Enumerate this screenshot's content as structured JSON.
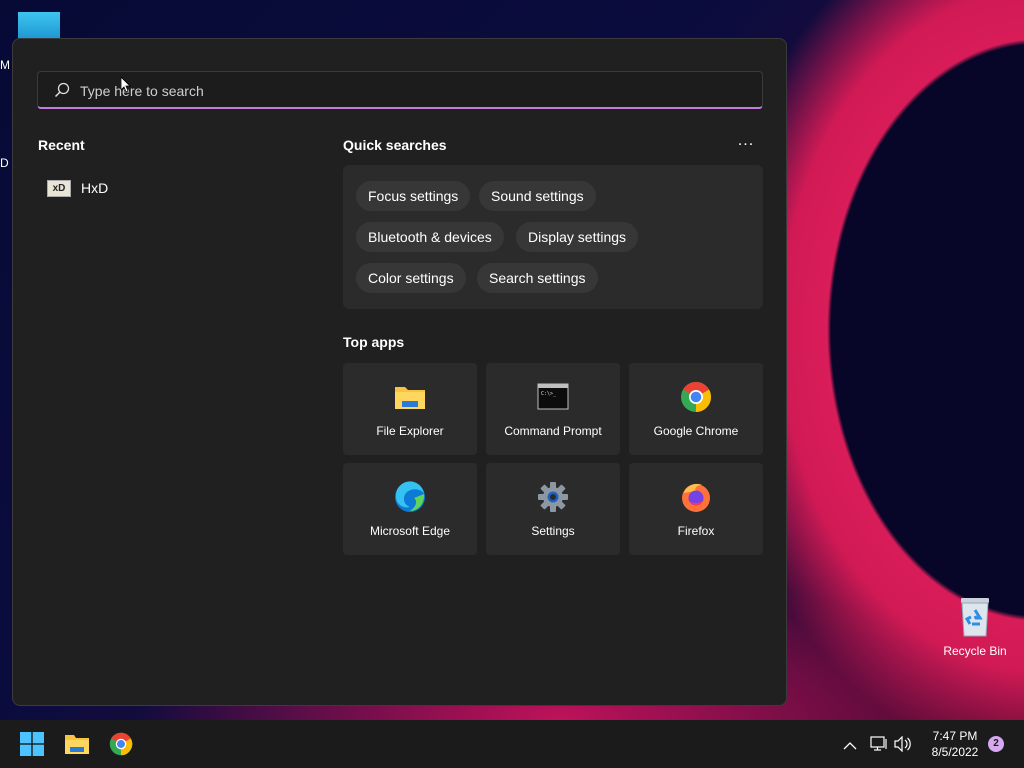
{
  "desktop": {
    "fragment_m": "M",
    "fragment_d": "D",
    "recycle_bin_label": "Recycle Bin"
  },
  "start": {
    "search_placeholder": "Type here to search",
    "recent_title": "Recent",
    "recent_items": [
      {
        "label": "HxD",
        "icon": "hxd-icon"
      }
    ],
    "quick_searches_title": "Quick searches",
    "more_label": "...",
    "quick_searches": [
      "Focus settings",
      "Sound settings",
      "Bluetooth & devices",
      "Display settings",
      "Color settings",
      "Search settings"
    ],
    "top_apps_title": "Top apps",
    "top_apps": [
      {
        "label": "File Explorer",
        "icon": "folder-icon"
      },
      {
        "label": "Command Prompt",
        "icon": "terminal-icon"
      },
      {
        "label": "Google Chrome",
        "icon": "chrome-icon"
      },
      {
        "label": "Microsoft Edge",
        "icon": "edge-icon"
      },
      {
        "label": "Settings",
        "icon": "gear-icon"
      },
      {
        "label": "Firefox",
        "icon": "firefox-icon"
      }
    ]
  },
  "taskbar": {
    "time": "7:47 PM",
    "date": "8/5/2022",
    "notification_count": "2"
  },
  "colors": {
    "panel_bg": "#202020",
    "search_accent": "#c47be0",
    "taskbar_bg": "#1b1b1c"
  }
}
